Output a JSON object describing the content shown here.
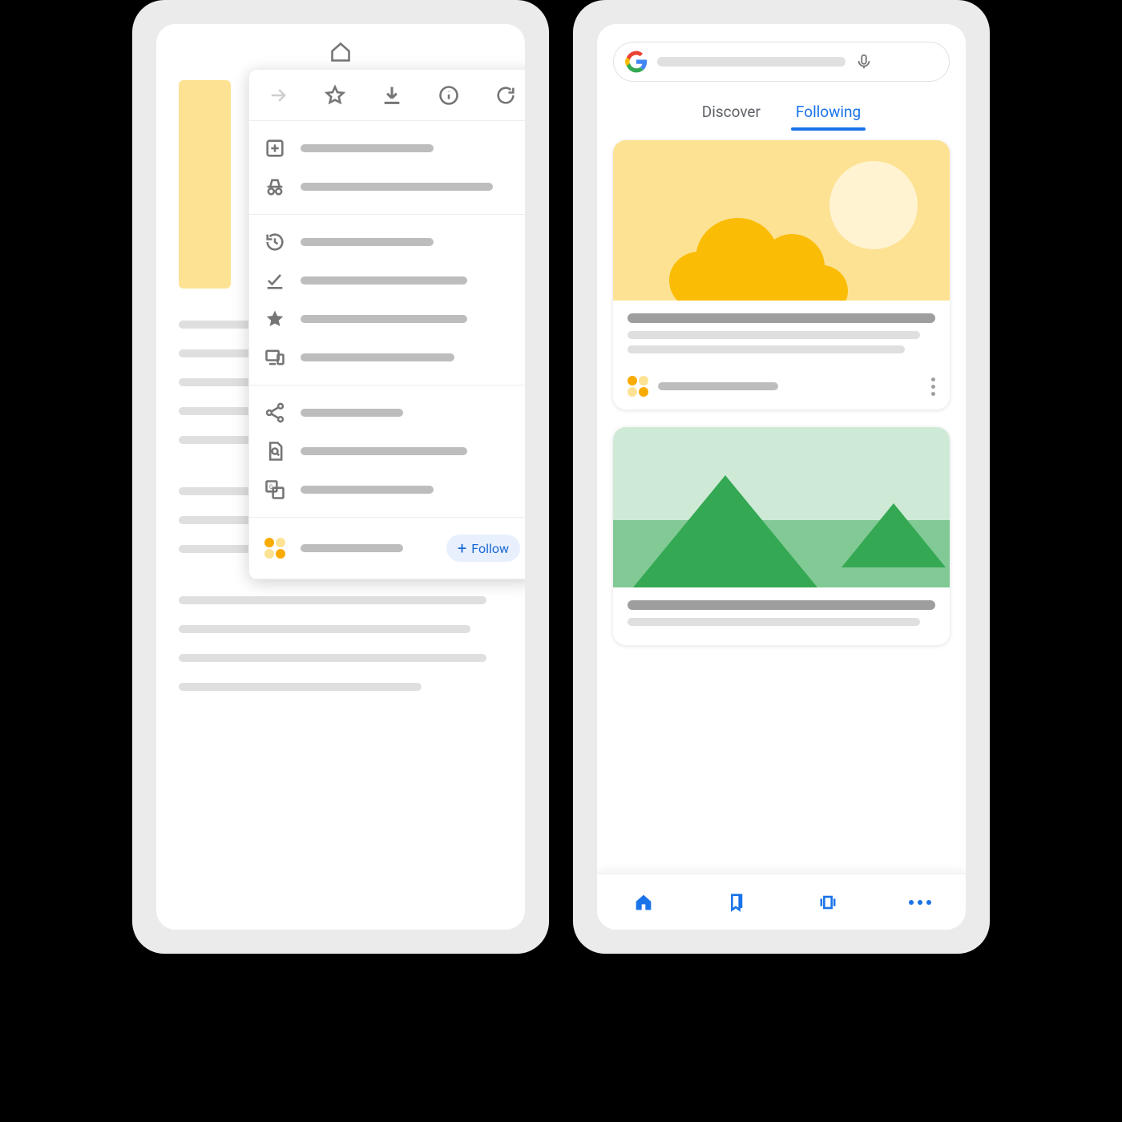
{
  "left": {
    "toolbar_icons": [
      "home",
      "forward",
      "star",
      "download",
      "info",
      "refresh"
    ],
    "menu": {
      "top_icons": [
        "forward",
        "star",
        "download",
        "info",
        "refresh"
      ],
      "section1_icons": [
        "new-tab",
        "incognito"
      ],
      "section2_icons": [
        "history",
        "check-done",
        "star-filled",
        "devices"
      ],
      "section3_icons": [
        "share",
        "find-in-page",
        "translate"
      ],
      "follow_icon": "site-dots",
      "follow_label": "Follow"
    }
  },
  "right": {
    "search_placeholder": "",
    "tabs": {
      "discover": "Discover",
      "following": "Following",
      "active": "following"
    },
    "nav_icons": [
      "home",
      "bookmarks",
      "tabs",
      "more"
    ]
  }
}
